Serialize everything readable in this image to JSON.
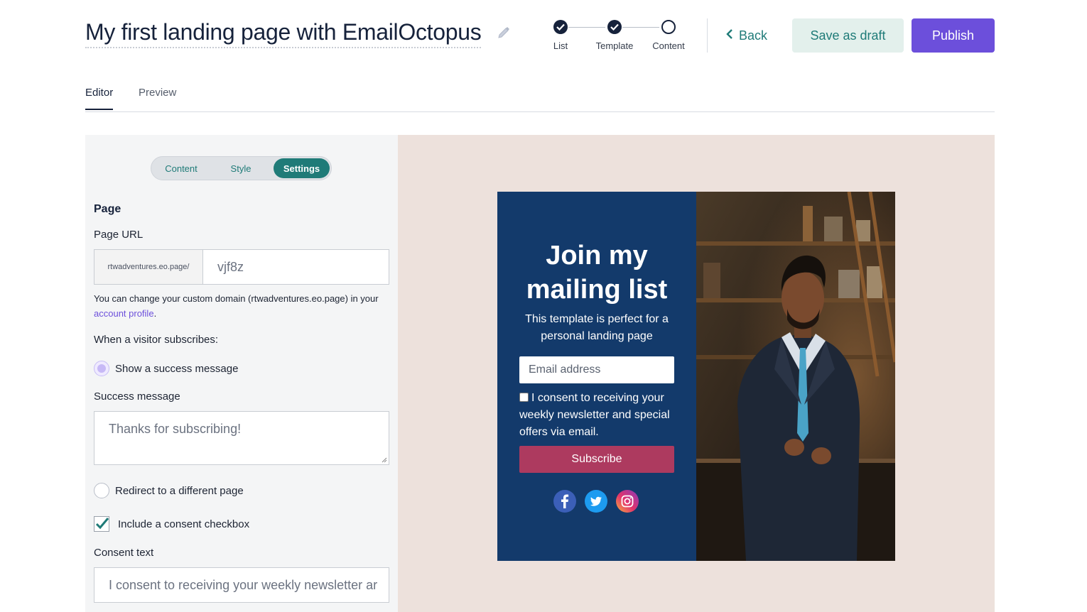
{
  "header": {
    "title": "My first landing page with EmailOctopus",
    "steps": [
      {
        "label": "List",
        "state": "done"
      },
      {
        "label": "Template",
        "state": "done"
      },
      {
        "label": "Content",
        "state": "current"
      }
    ],
    "back_label": "Back",
    "save_draft_label": "Save as draft",
    "publish_label": "Publish"
  },
  "tabs": {
    "editor": "Editor",
    "preview": "Preview",
    "active": "Editor"
  },
  "settings": {
    "segments": [
      "Content",
      "Style",
      "Settings"
    ],
    "active_segment": "Settings",
    "section_title": "Page",
    "page_url_label": "Page URL",
    "url_prefix": "rtwadventures.eo.page/",
    "url_slug": "vjf8z",
    "help_text_before": "You can change your custom domain (rtwadventures.eo.page) in your ",
    "help_link": "account profile",
    "help_text_after": ".",
    "subscribe_label": "When a visitor subscribes:",
    "option_success": "Show a success message",
    "success_message_label": "Success message",
    "success_message_value": "Thanks for subscribing!",
    "option_redirect": "Redirect to a different page",
    "consent_checkbox_label": "Include a consent checkbox",
    "consent_checked": true,
    "consent_text_label": "Consent text",
    "consent_text_value": "I consent to receiving your weekly newsletter ar"
  },
  "preview": {
    "heading": "Join my mailing list",
    "subheading": "This template is perfect for a personal landing page",
    "email_placeholder": "Email address",
    "consent": "I consent to receiving your weekly newsletter and special offers via email.",
    "subscribe_label": "Subscribe",
    "socials": [
      "facebook-icon",
      "twitter-icon",
      "instagram-icon"
    ]
  },
  "colors": {
    "accent_purple": "#6c4fdb",
    "teal": "#1f7b78",
    "navy": "#133a6b",
    "subscribe": "#ad3a5f",
    "preview_bg": "#ede1dc"
  }
}
